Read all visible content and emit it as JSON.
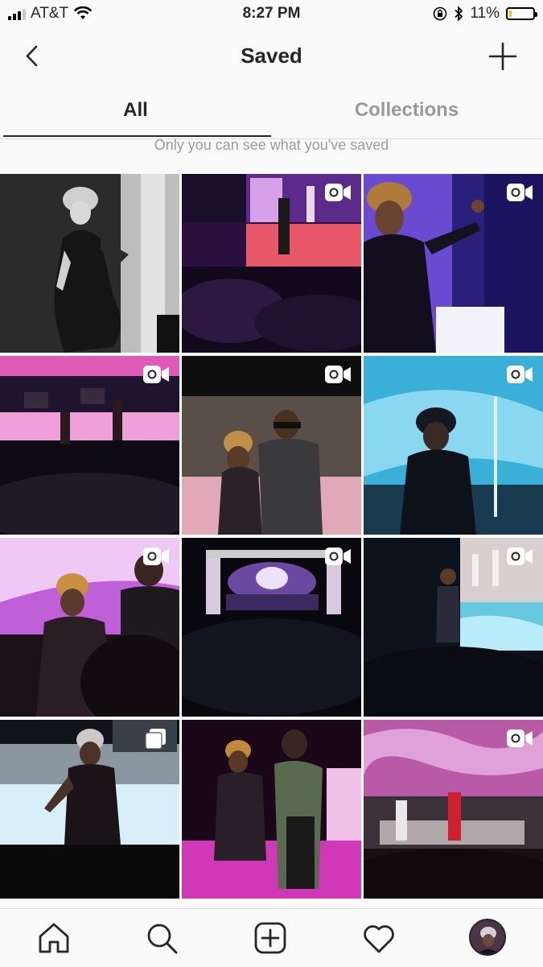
{
  "status_bar": {
    "carrier": "AT&T",
    "time": "8:27 PM",
    "battery": "11%",
    "battery_level": 0.11,
    "icons": [
      "signal-icon",
      "wifi-icon",
      "orientation-lock-icon",
      "bluetooth-icon",
      "battery-icon"
    ]
  },
  "header": {
    "title": "Saved",
    "back_icon": "chevron-left-icon",
    "add_icon": "plus-icon"
  },
  "tabs": [
    {
      "label": "All",
      "selected": true
    },
    {
      "label": "Collections",
      "selected": false
    }
  ],
  "notice": "Only you can see what you've saved",
  "grid": {
    "items": [
      {
        "type": "photo"
      },
      {
        "type": "video"
      },
      {
        "type": "video"
      },
      {
        "type": "video"
      },
      {
        "type": "video"
      },
      {
        "type": "video"
      },
      {
        "type": "video"
      },
      {
        "type": "video"
      },
      {
        "type": "video"
      },
      {
        "type": "carousel"
      },
      {
        "type": "photo"
      },
      {
        "type": "video"
      }
    ],
    "badge_icons": {
      "video": "video-camera-icon",
      "carousel": "carousel-icon"
    }
  },
  "bottom_nav": {
    "items": [
      "home-icon",
      "search-icon",
      "add-post-icon",
      "activity-heart-icon",
      "profile-avatar"
    ]
  },
  "colors": {
    "background": "#fafafa",
    "text": "#262626",
    "muted": "#999999",
    "divider": "#dbdbdb",
    "battery_fill": "#f5c100"
  }
}
